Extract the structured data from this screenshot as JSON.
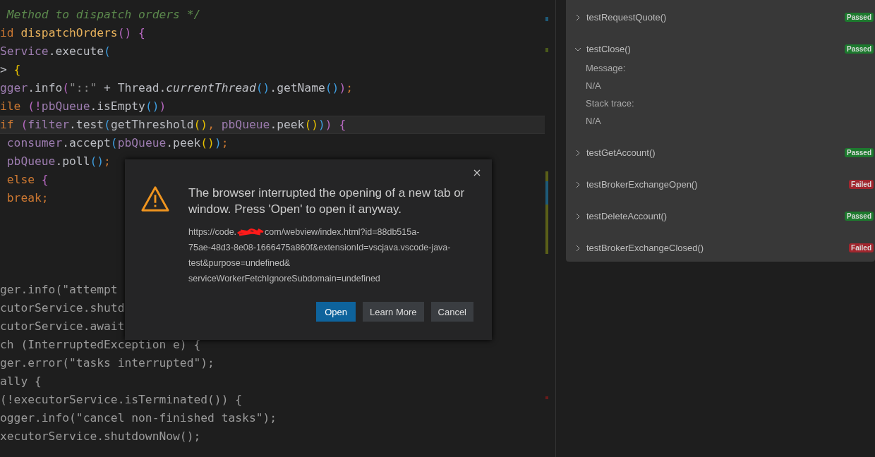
{
  "editor": {
    "lines": [
      {
        "current": false,
        "tokens": [
          {
            "kind": "comment",
            "text": " Method to dispatch orders */"
          }
        ]
      },
      {
        "current": false,
        "tokens": [
          {
            "kind": "keyword",
            "text": "id "
          },
          {
            "kind": "method",
            "text": "dispatchOrders"
          },
          {
            "kind": "bracket2",
            "text": "() {"
          }
        ]
      },
      {
        "current": false,
        "tokens": [
          {
            "kind": "variable",
            "text": "Service"
          },
          {
            "kind": "plain",
            "text": ".execute"
          },
          {
            "kind": "bracket3",
            "text": "("
          }
        ]
      },
      {
        "current": false,
        "tokens": [
          {
            "kind": "plain",
            "text": "> "
          },
          {
            "kind": "bracket1",
            "text": "{"
          }
        ]
      },
      {
        "current": false,
        "tokens": [
          {
            "kind": "variable",
            "text": "gger"
          },
          {
            "kind": "plain",
            "text": ".info"
          },
          {
            "kind": "bracket2",
            "text": "("
          },
          {
            "kind": "string",
            "text": "\"::\""
          },
          {
            "kind": "plain",
            "text": " + Thread."
          },
          {
            "kind": "italic",
            "text": "currentThread"
          },
          {
            "kind": "bracket3",
            "text": "()"
          },
          {
            "kind": "plain",
            "text": ".getName"
          },
          {
            "kind": "bracket3",
            "text": "()"
          },
          {
            "kind": "bracket2",
            "text": ")"
          },
          {
            "kind": "keyword",
            "text": ";"
          }
        ]
      },
      {
        "current": false,
        "tokens": [
          {
            "kind": "keyword",
            "text": "ile "
          },
          {
            "kind": "bracket2",
            "text": "(!"
          },
          {
            "kind": "variable",
            "text": "pbQueue"
          },
          {
            "kind": "plain",
            "text": ".isEmpty"
          },
          {
            "kind": "bracket3",
            "text": "()"
          },
          {
            "kind": "bracket2",
            "text": ")"
          }
        ]
      },
      {
        "current": true,
        "tokens": [
          {
            "kind": "keyword",
            "text": "if "
          },
          {
            "kind": "bracket2",
            "text": "("
          },
          {
            "kind": "variable",
            "text": "filter"
          },
          {
            "kind": "plain",
            "text": ".test"
          },
          {
            "kind": "bracket3",
            "text": "("
          },
          {
            "kind": "plain",
            "text": "getThreshold"
          },
          {
            "kind": "bracket1",
            "text": "()"
          },
          {
            "kind": "keyword",
            "text": ", "
          },
          {
            "kind": "variable",
            "text": "pbQueue"
          },
          {
            "kind": "plain",
            "text": ".peek"
          },
          {
            "kind": "bracket1",
            "text": "()"
          },
          {
            "kind": "bracket3",
            "text": ")"
          },
          {
            "kind": "bracket2",
            "text": ") {"
          }
        ]
      },
      {
        "current": false,
        "tokens": [
          {
            "kind": "variable",
            "text": " consumer"
          },
          {
            "kind": "plain",
            "text": ".accept"
          },
          {
            "kind": "bracket3",
            "text": "("
          },
          {
            "kind": "variable",
            "text": "pbQueue"
          },
          {
            "kind": "plain",
            "text": ".peek"
          },
          {
            "kind": "bracket1",
            "text": "()"
          },
          {
            "kind": "bracket3",
            "text": ")"
          },
          {
            "kind": "keyword",
            "text": ";"
          }
        ]
      },
      {
        "current": false,
        "tokens": [
          {
            "kind": "variable",
            "text": " pbQueue"
          },
          {
            "kind": "plain",
            "text": ".poll"
          },
          {
            "kind": "bracket3",
            "text": "()"
          },
          {
            "kind": "keyword",
            "text": ";"
          }
        ]
      },
      {
        "current": false,
        "tokens": [
          {
            "kind": "keyword",
            "text": " else "
          },
          {
            "kind": "bracket2",
            "text": "{"
          }
        ]
      },
      {
        "current": false,
        "tokens": [
          {
            "kind": "keyword",
            "text": " break;"
          }
        ]
      },
      {
        "current": false
      },
      {
        "current": false
      },
      {
        "current": false
      },
      {
        "current": false
      },
      {
        "current": false,
        "tokens": [
          {
            "kind": "dim",
            "text": "ger.info(\"attempt"
          }
        ]
      },
      {
        "current": false,
        "tokens": [
          {
            "kind": "dim",
            "text": "cutorService.shutd"
          }
        ]
      },
      {
        "current": false,
        "tokens": [
          {
            "kind": "dim",
            "text": "cutorService.await"
          }
        ]
      },
      {
        "current": false,
        "tokens": [
          {
            "kind": "dim",
            "text": "ch (InterruptedException e) {"
          }
        ]
      },
      {
        "current": false,
        "tokens": [
          {
            "kind": "dim",
            "text": "ger.error(\"tasks interrupted\");"
          }
        ]
      },
      {
        "current": false,
        "tokens": [
          {
            "kind": "dim",
            "text": "ally {"
          }
        ]
      },
      {
        "current": false,
        "tokens": [
          {
            "kind": "dim",
            "text": "(!executorService.isTerminated()) {"
          }
        ]
      },
      {
        "current": false,
        "tokens": [
          {
            "kind": "dim",
            "text": "ogger.info(\"cancel non-finished tasks\");"
          }
        ]
      },
      {
        "current": false,
        "tokens": [
          {
            "kind": "dim",
            "text": "xecutorService.shutdownNow();"
          }
        ]
      }
    ]
  },
  "tests": [
    {
      "name": "testRequestQuote()",
      "status": "Passed",
      "passed": true,
      "expanded": false
    },
    {
      "name": "testClose()",
      "status": "Passed",
      "passed": true,
      "expanded": true,
      "details": [
        "Message:",
        "N/A",
        "Stack trace:",
        "N/A"
      ]
    },
    {
      "name": "testGetAccount()",
      "status": "Passed",
      "passed": true,
      "expanded": false
    },
    {
      "name": "testBrokerExchangeOpen()",
      "status": "Failed",
      "passed": false,
      "expanded": false
    },
    {
      "name": "testDeleteAccount()",
      "status": "Passed",
      "passed": true,
      "expanded": false
    },
    {
      "name": "testBrokerExchangeClosed()",
      "status": "Failed",
      "passed": false,
      "expanded": false
    }
  ],
  "dialog": {
    "message": "The browser interrupted the opening of a new tab or window. Press 'Open' to open it anyway.",
    "url_prefix": "https://code.",
    "url_lines": [
      "com/webview/index.html?id=88db515a-",
      "75ae-48d3-8e08-1666475a860f&extensionId=vscjava.vscode-java-",
      "test&purpose=undefined&",
      "serviceWorkerFetchIgnoreSubdomain=undefined"
    ],
    "buttons": [
      {
        "label": "Open",
        "primary": true
      },
      {
        "label": "Learn More",
        "primary": false
      },
      {
        "label": "Cancel",
        "primary": false
      }
    ]
  }
}
